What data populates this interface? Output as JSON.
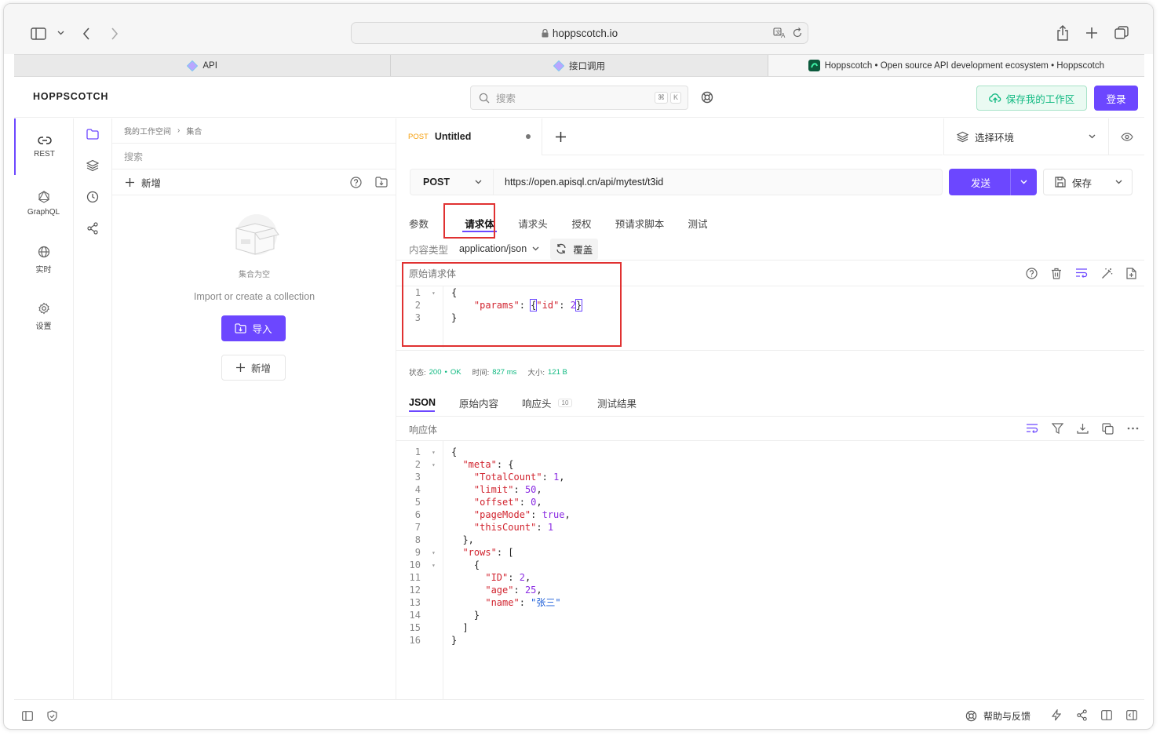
{
  "browser": {
    "url": "hoppscotch.io",
    "tabs": [
      {
        "label": "API"
      },
      {
        "label": "接口调用"
      },
      {
        "label": "Hoppscotch • Open source API development ecosystem • Hoppscotch"
      }
    ]
  },
  "app": {
    "brand": "HOPPSCOTCH",
    "search_placeholder": "搜索",
    "kbd1": "⌘",
    "kbd2": "K",
    "save_workspace": "保存我的工作区",
    "login": "登录",
    "accent": "#6c47ff"
  },
  "rail": [
    {
      "label": "REST",
      "icon": "link-icon"
    },
    {
      "label": "GraphQL",
      "icon": "graphql-icon"
    },
    {
      "label": "实时",
      "icon": "globe-icon"
    },
    {
      "label": "设置",
      "icon": "gear-icon"
    }
  ],
  "collections": {
    "breadcrumb_root": "我的工作空间",
    "breadcrumb_sep": "›",
    "breadcrumb_current": "集合",
    "search_placeholder": "搜索",
    "new_label": "新增",
    "empty_title": "集合为空",
    "empty_desc": "Import or create a collection",
    "import_label": "导入",
    "new_button": "新增"
  },
  "request": {
    "tab_method": "POST",
    "tab_title": "Untitled",
    "env_select": "选择环境",
    "method": "POST",
    "url": "https://open.apisql.cn/api/mytest/t3id",
    "send": "发送",
    "save": "保存",
    "subtabs": [
      "参数",
      "请求体",
      "请求头",
      "授权",
      "预请求脚本",
      "测试"
    ],
    "content_type_label": "内容类型",
    "content_type": "application/json",
    "override": "覆盖",
    "raw_body_label": "原始请求体",
    "body_lines": [
      "1",
      "2",
      "3"
    ]
  },
  "response": {
    "status_label": "状态:",
    "status_code": "200",
    "status_dot": "•",
    "status_text": "OK",
    "time_label": "时间:",
    "time_value": "827 ms",
    "size_label": "大小:",
    "size_value": "121 B",
    "tabs": [
      "JSON",
      "原始内容",
      "响应头",
      "测试结果"
    ],
    "headers_count": "10",
    "body_label": "响应体",
    "lines": [
      "1",
      "2",
      "3",
      "4",
      "5",
      "6",
      "7",
      "8",
      "9",
      "10",
      "11",
      "12",
      "13",
      "14",
      "15",
      "16"
    ]
  },
  "footer": {
    "help": "帮助与反馈"
  }
}
